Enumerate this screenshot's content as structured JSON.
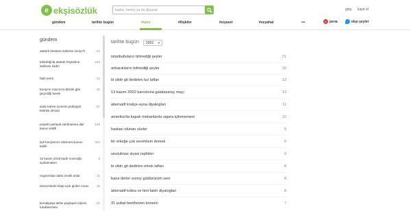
{
  "header": {
    "logo_text": "ekşisözlük",
    "search_placeholder": "başlık, #entry ya da @yazar",
    "login_label": "giriş",
    "register_label": "kayıt ol"
  },
  "nav": {
    "items": [
      "gündem",
      "tarihte bugün",
      "#spor",
      "#ilişkiler",
      "#siyaset",
      "#seyahat",
      "•••"
    ],
    "pena_label": "pena",
    "eksi_seyler_label": "ekşi şeyler"
  },
  "sidebar": {
    "title": "gündem",
    "items": [
      {
        "title": "atatürk büstüne saldıran suriye'li",
        "count": "43"
      },
      {
        "title": "tekirdağ'da atatürk heykeline saldıran kadın",
        "count": "182"
      },
      {
        "title": "fatih terim",
        "count": "13"
      },
      {
        "title": "trump'ın macron'a bilezik gibi geçirdiği tweeti",
        "count": "15"
      },
      {
        "title": "sade kahve içmenin psikopati belirtisi olması",
        "count": "57"
      },
      {
        "title": "poşetin parayla satılmasına dair kanun teklifi",
        "count": "149"
      },
      {
        "title": "kyk borçlarının silinmesi kanun teklifi",
        "count": "344"
      },
      {
        "title": "13 kasım 2018 kadir mısıroğlu açıklamaları",
        "count": "8"
      },
      {
        "title": "orgazmdan daha zevkli anlar",
        "count": "11"
      },
      {
        "title": "üniversitede kitap açık girilen sınav",
        "count": "18"
      },
      {
        "title": "kemalpaşa tatlısı paylaşan kişinin tutuklanması",
        "count": "20"
      }
    ]
  },
  "main": {
    "title": "tarihte bugün",
    "year_selected": "2002",
    "topics": [
      {
        "title": "istanbulluların bilmediği şeyler",
        "count": "21"
      },
      {
        "title": "ankaralıların bilmediği şeyler",
        "count": "16"
      },
      {
        "title": "bi siktir git dedirten kız lafları",
        "count": "13"
      },
      {
        "title": "13 kasım 2002 barcelona galatasaray maçı",
        "count": "13"
      },
      {
        "title": "alternatif kraliçe-ayna diyalogları",
        "count": "11"
      },
      {
        "title": "amerika'da kapalı mekanlarda sigara içilememesi",
        "count": "10"
      },
      {
        "title": "hastası olunan sözler",
        "count": "9"
      },
      {
        "title": "bir erkeğe çok sevimlisin demek",
        "count": "9"
      },
      {
        "title": "unutulmaz siyasi replikler",
        "count": "9"
      },
      {
        "title": "bi siktir git dedirten erkek lafları",
        "count": "8"
      },
      {
        "title": "bana derler sunny güldürürüm seni",
        "count": "8"
      },
      {
        "title": "alternatif kobra ve hint fakiri diyalogları",
        "count": "8"
      },
      {
        "title": "31 şubat beethoven konseri",
        "count": "7"
      }
    ]
  },
  "colors": {
    "brand_green": "#81c14b",
    "pena_red": "#e53935",
    "eksi_seyler_blue": "#2196f3"
  },
  "icons": [
    "search-icon",
    "chevron-down-icon",
    "pena-icon",
    "eksi-seyler-icon",
    "more-icon"
  ]
}
